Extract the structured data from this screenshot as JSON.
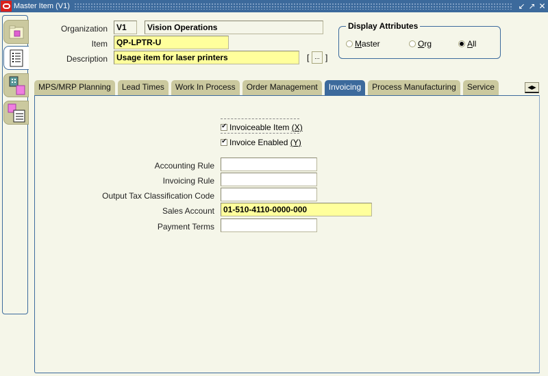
{
  "window": {
    "title": "Master Item (V1)",
    "controls": [
      "minimize-icon",
      "maximize-icon",
      "close-icon"
    ]
  },
  "left_toolbar": {
    "items": [
      {
        "name": "item-folder",
        "icon": "folder-cube-icon"
      },
      {
        "name": "item-attributes",
        "icon": "list-icon",
        "active": true
      },
      {
        "name": "item-organizations",
        "icon": "building-cube-icon"
      },
      {
        "name": "item-categories",
        "icon": "cube-list-icon"
      }
    ]
  },
  "header": {
    "organization_label": "Organization",
    "organization_code": "V1",
    "organization_name": "Vision Operations",
    "item_label": "Item",
    "item_value": "QP-LPTR-U",
    "description_label": "Description",
    "description_value": "Usage item for laser printers",
    "dff_button": "...",
    "dff_open": "[",
    "dff_close": "]"
  },
  "display_attributes": {
    "title": "Display Attributes",
    "options": [
      {
        "label": "Master",
        "mnemonic": "M",
        "rest": "aster",
        "selected": false
      },
      {
        "label": "Org",
        "mnemonic": "O",
        "rest": "rg",
        "selected": false
      },
      {
        "label": "All",
        "mnemonic": "A",
        "rest": "ll",
        "selected": true
      }
    ]
  },
  "tabs": [
    {
      "label": "MPS/MRP Planning",
      "active": false
    },
    {
      "label": "Lead Times",
      "active": false
    },
    {
      "label": "Work In Process",
      "active": false
    },
    {
      "label": "Order Management",
      "active": false
    },
    {
      "label": "Invoicing",
      "active": true
    },
    {
      "label": "Process Manufacturing",
      "active": false
    },
    {
      "label": "Service",
      "active": false
    }
  ],
  "invoicing": {
    "invoiceable_item": {
      "label": "Invoiceable Item",
      "shortcut": "(X)",
      "checked": true
    },
    "invoice_enabled": {
      "label": "Invoice Enabled",
      "shortcut": "(Y)",
      "checked": true
    },
    "fields": [
      {
        "label": "Accounting Rule",
        "value": "",
        "style": "white"
      },
      {
        "label": "Invoicing Rule",
        "value": "",
        "style": "white"
      },
      {
        "label": "Output Tax Classification Code",
        "value": "",
        "style": "white"
      },
      {
        "label": "Sales Account",
        "value": "01-510-4110-0000-000",
        "style": "yellow"
      },
      {
        "label": "Payment Terms",
        "value": "",
        "style": "white"
      }
    ]
  },
  "colors": {
    "titlebar": "#3c6a9c",
    "background": "#f5f6e9",
    "tab_inactive": "#cbc99f",
    "tab_active": "#3c6a9c",
    "required_field": "#ffff9c"
  }
}
